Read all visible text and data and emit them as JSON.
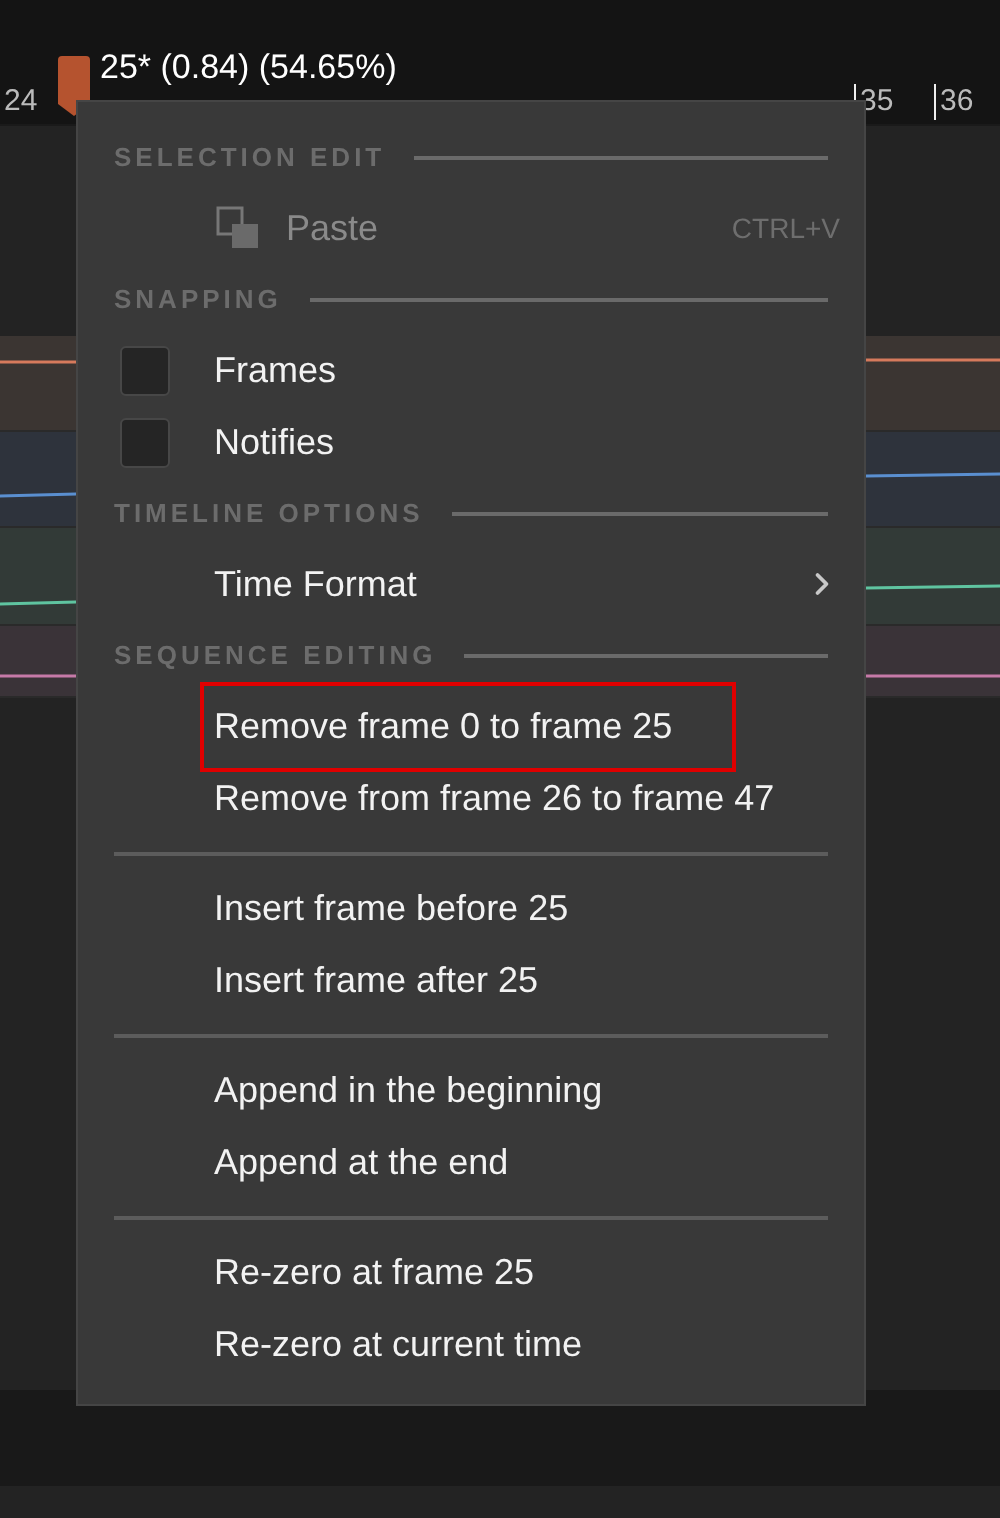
{
  "playhead": {
    "label": "25* (0.84) (54.65%)"
  },
  "ruler": {
    "ticks": [
      "24",
      "35",
      "36"
    ]
  },
  "tracks": [
    {
      "color": "#d67a5c"
    },
    {
      "color": "#5a8fd0"
    },
    {
      "color": "#5fc4a0"
    },
    {
      "color": "#c67aa8"
    }
  ],
  "menu": {
    "sections": [
      {
        "title": "SELECTION EDIT",
        "items": [
          {
            "kind": "action",
            "label": "Paste",
            "shortcut": "CTRL+V",
            "disabled": true
          }
        ]
      },
      {
        "title": "SNAPPING",
        "items": [
          {
            "kind": "checkbox",
            "label": "Frames",
            "checked": false
          },
          {
            "kind": "checkbox",
            "label": "Notifies",
            "checked": false
          }
        ]
      },
      {
        "title": "TIMELINE OPTIONS",
        "items": [
          {
            "kind": "submenu",
            "label": "Time Format"
          }
        ]
      },
      {
        "title": "SEQUENCE EDITING",
        "items": [
          {
            "kind": "action",
            "label": "Remove frame 0 to frame 25",
            "highlighted": true
          },
          {
            "kind": "action",
            "label": "Remove from frame 26 to frame 47",
            "highlighted": false
          }
        ]
      },
      {
        "items": [
          {
            "kind": "action",
            "label": "Insert frame before 25"
          },
          {
            "kind": "action",
            "label": "Insert frame after 25"
          }
        ]
      },
      {
        "items": [
          {
            "kind": "action",
            "label": "Append in the beginning"
          },
          {
            "kind": "action",
            "label": "Append at the end"
          }
        ]
      },
      {
        "items": [
          {
            "kind": "action",
            "label": "Re-zero at frame 25"
          },
          {
            "kind": "action",
            "label": "Re-zero at current time"
          }
        ]
      }
    ]
  }
}
